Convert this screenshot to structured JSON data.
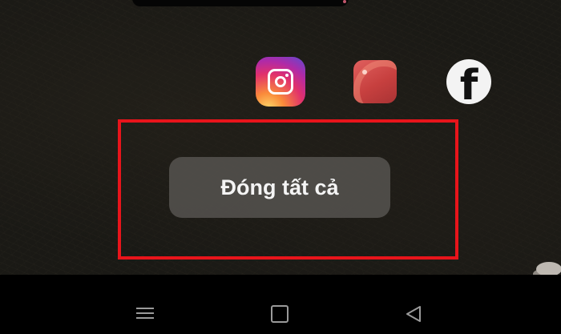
{
  "recent_apps": {
    "icons": [
      "instagram-icon",
      "gallery-icon",
      "facebook-icon"
    ],
    "close_all_label": "Đóng tất cả",
    "highlight_color": "#e8141b"
  },
  "navbar": {
    "buttons": [
      "menu-icon",
      "home-icon",
      "back-icon"
    ]
  }
}
